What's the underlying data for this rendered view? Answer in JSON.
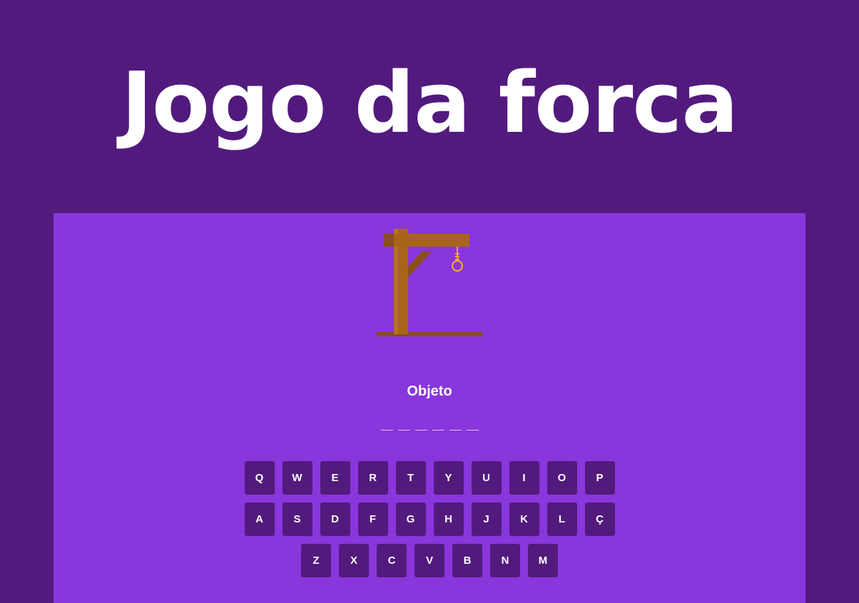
{
  "header": {
    "title": "Jogo da forca"
  },
  "game": {
    "category": "Objeto",
    "word_length": 6,
    "gallows_icon": "gallows-icon",
    "colors": {
      "background": "#521a7d",
      "panel": "#8936dc",
      "key": "#521a7d",
      "wood": "#a8651a",
      "rope": "#f2a33a"
    }
  },
  "keyboard": {
    "rows": [
      [
        "Q",
        "W",
        "E",
        "R",
        "T",
        "Y",
        "U",
        "I",
        "O",
        "P"
      ],
      [
        "A",
        "S",
        "D",
        "F",
        "G",
        "H",
        "J",
        "K",
        "L",
        "Ç"
      ],
      [
        "Z",
        "X",
        "C",
        "V",
        "B",
        "N",
        "M"
      ]
    ]
  }
}
